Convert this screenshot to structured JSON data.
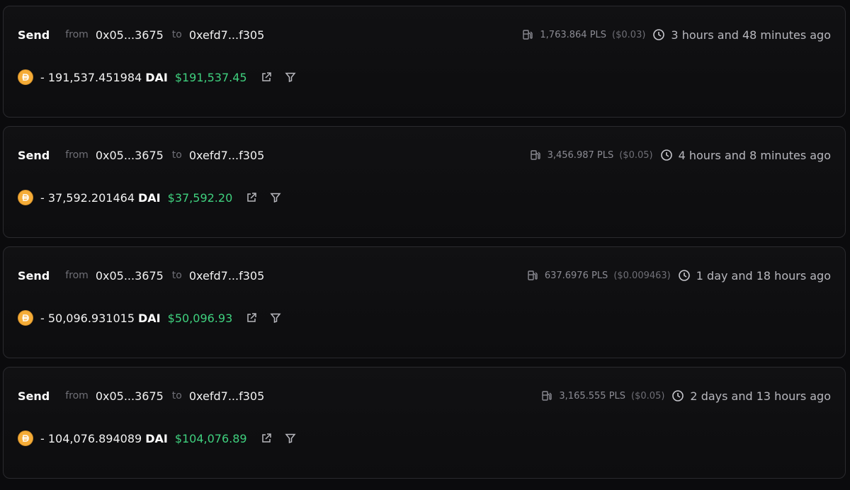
{
  "transactions": [
    {
      "type": "Send",
      "from_label": "from",
      "from": "0x05...3675",
      "to_label": "to",
      "to": "0xefd7...f305",
      "gas_amount": "1,763.864 PLS",
      "gas_usd": "($0.03)",
      "time_ago": "3 hours and 48 minutes ago",
      "amount": "- 191,537.451984",
      "symbol": "DAI",
      "usd_value": "$191,537.45"
    },
    {
      "type": "Send",
      "from_label": "from",
      "from": "0x05...3675",
      "to_label": "to",
      "to": "0xefd7...f305",
      "gas_amount": "3,456.987 PLS",
      "gas_usd": "($0.05)",
      "time_ago": "4 hours and 8 minutes ago",
      "amount": "- 37,592.201464",
      "symbol": "DAI",
      "usd_value": "$37,592.20"
    },
    {
      "type": "Send",
      "from_label": "from",
      "from": "0x05...3675",
      "to_label": "to",
      "to": "0xefd7...f305",
      "gas_amount": "637.6976 PLS",
      "gas_usd": "($0.009463)",
      "time_ago": "1 day and 18 hours ago",
      "amount": "- 50,096.931015",
      "symbol": "DAI",
      "usd_value": "$50,096.93"
    },
    {
      "type": "Send",
      "from_label": "from",
      "from": "0x05...3675",
      "to_label": "to",
      "to": "0xefd7...f305",
      "gas_amount": "3,165.555 PLS",
      "gas_usd": "($0.05)",
      "time_ago": "2 days and 13 hours ago",
      "amount": "- 104,076.894089",
      "symbol": "DAI",
      "usd_value": "$104,076.89"
    }
  ],
  "icons": {
    "gas": "gas-pump-icon",
    "time": "clock-icon",
    "token": "dai-token-icon",
    "external": "external-link-icon",
    "filter": "filter-icon"
  },
  "colors": {
    "background": "#0b0b0d",
    "card_border": "#2a2a2e",
    "usd_positive": "#3fd07e",
    "muted_text": "#6f6f76",
    "token_dai": "#f5ac37"
  }
}
